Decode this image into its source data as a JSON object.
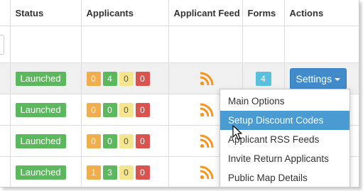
{
  "headers": {
    "status": "Status",
    "applicants": "Applicants",
    "feed": "Applicant Feed",
    "forms": "Forms",
    "actions": "Actions"
  },
  "rows": [
    {
      "status": "Launched",
      "counts": [
        "0",
        "4",
        "0",
        "0"
      ],
      "forms": "4",
      "action": "Settings"
    },
    {
      "status": "Launched",
      "counts": [
        "0",
        "0",
        "0",
        "0"
      ]
    },
    {
      "status": "Launched",
      "counts": [
        "0",
        "0",
        "0",
        "0"
      ]
    },
    {
      "status": "Launched",
      "counts": [
        "1",
        "3",
        "0",
        "0"
      ]
    }
  ],
  "menu": {
    "items": [
      "Main Options",
      "Setup Discount Codes",
      "Applicant RSS Feeds",
      "Invite Return Applicants",
      "Public Map Details"
    ],
    "active_index": 1
  },
  "icons": {
    "feed": "rss-icon",
    "cursor": "mouse-pointer-icon"
  },
  "colors": {
    "launched": "#5cb85c",
    "badge_new": "#f0ad4e",
    "badge_reviewed": "#5cb85c",
    "badge_hold": "#f5e58f",
    "badge_rejected": "#d9534f",
    "forms": "#5bc0de",
    "settings": "#428bca",
    "rss": "#f7941d",
    "menu_active": "#4a9bd1"
  }
}
